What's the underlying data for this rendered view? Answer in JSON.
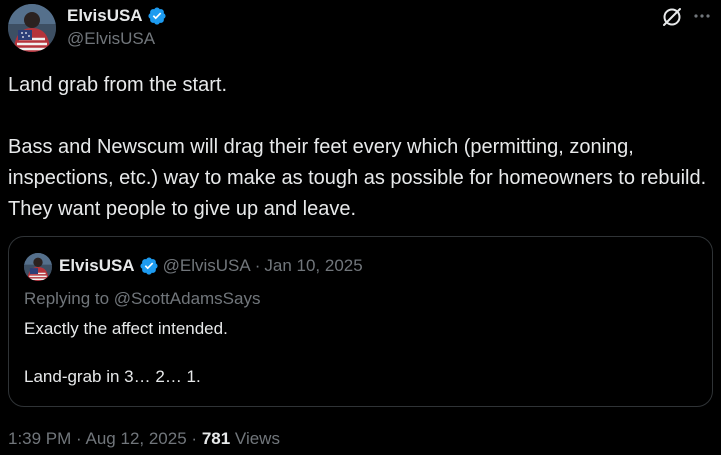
{
  "author": {
    "display_name": "ElvisUSA",
    "handle": "@ElvisUSA",
    "verified": true,
    "avatar_icon": "flag-jacket-avatar"
  },
  "tweet": {
    "text": "Land grab from the start.\n\nBass and Newscum will drag their feet every which (permitting, zoning, inspections, etc.) way to make as tough as possible for homeowners to rebuild. They want people to give up and leave."
  },
  "quote": {
    "display_name": "ElvisUSA",
    "handle": "@ElvisUSA",
    "separator": "·",
    "date": "Jan 10, 2025",
    "replying_to": "Replying to @ScottAdamsSays",
    "text": "Exactly the affect intended.\n\nLand-grab in 3… 2… 1."
  },
  "meta": {
    "time": "1:39 PM",
    "sep1": "·",
    "date": "Aug 12, 2025",
    "sep2": "·",
    "views_count": "781",
    "views_label": "Views"
  },
  "colors": {
    "background": "#000000",
    "primary_text": "#e7e9ea",
    "secondary_text": "#71767b",
    "border": "#2f3336",
    "verified_blue": "#1d9bf0"
  }
}
